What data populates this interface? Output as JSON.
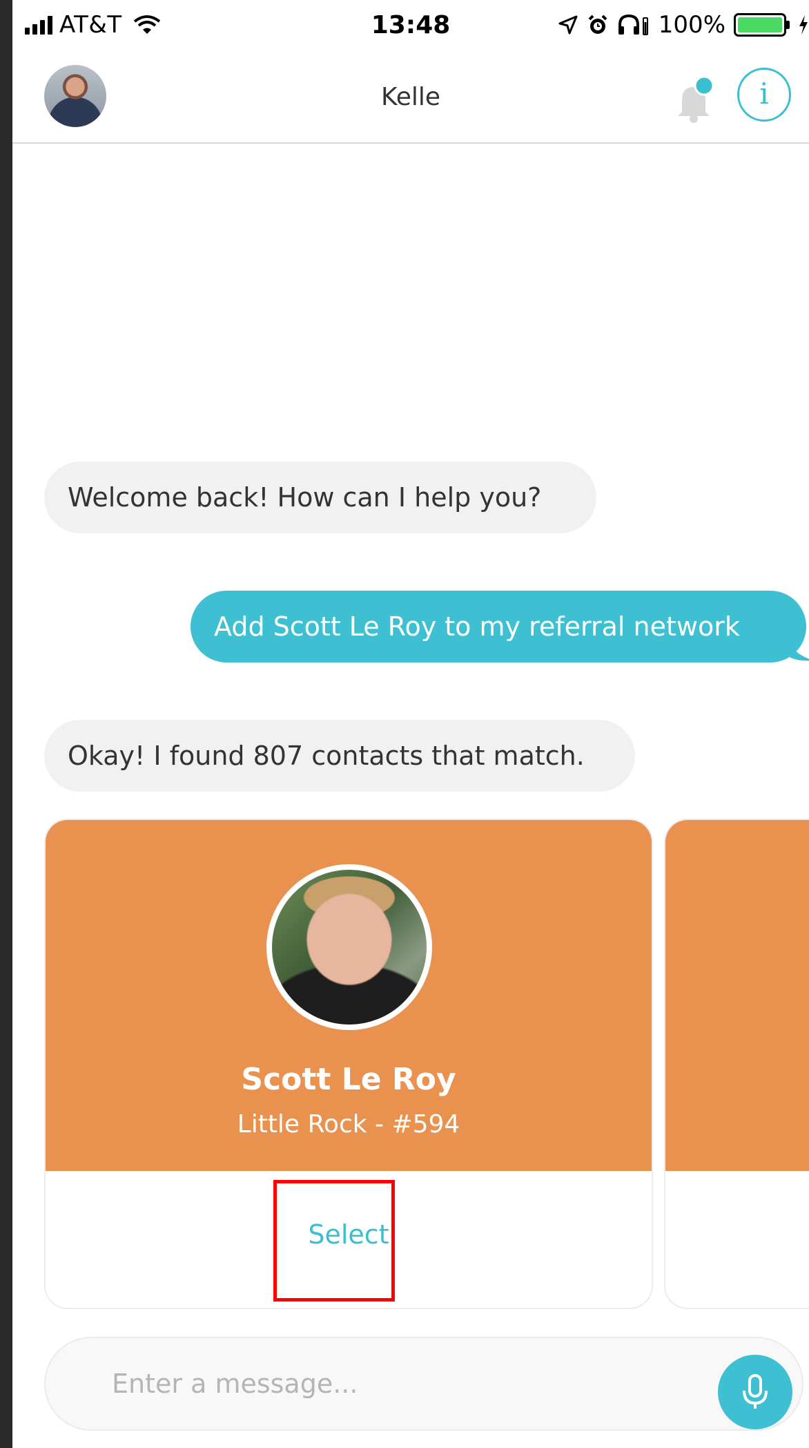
{
  "status_bar": {
    "carrier": "AT&T",
    "time": "13:48",
    "battery_percent": "100%",
    "battery_level": 1.0,
    "icons": [
      "signal-icon",
      "wifi-icon",
      "location-arrow-icon",
      "alarm-icon",
      "headphones-icon",
      "battery-icon",
      "charging-icon"
    ]
  },
  "header": {
    "title": "Kelle",
    "notification_dot": true,
    "info_label": "i"
  },
  "messages": [
    {
      "from": "bot",
      "text": "Welcome back! How can I help you?"
    },
    {
      "from": "user",
      "text": "Add Scott Le Roy to my referral network"
    },
    {
      "from": "bot",
      "text": "Okay! I found 807 contacts that match."
    }
  ],
  "contacts": [
    {
      "name": "Scott Le Roy",
      "subtitle": "Little Rock - #594",
      "action_label": "Select"
    }
  ],
  "composer": {
    "placeholder": "Enter a message...",
    "value": ""
  },
  "colors": {
    "accent": "#3ec0d2",
    "card": "#e9914f",
    "bubble_in": "#f1f1f1",
    "highlight": "#ff0000"
  }
}
